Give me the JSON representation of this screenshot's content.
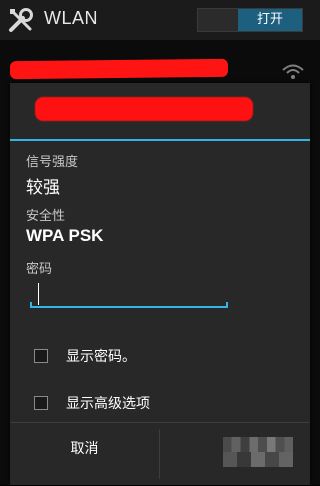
{
  "actionbar": {
    "title": "WLAN",
    "toggle_label": "打开"
  },
  "dialog": {
    "signal_label": "信号强度",
    "signal_value": "较强",
    "security_label": "安全性",
    "security_value": "WPA PSK",
    "password_label": "密码",
    "password_value": "",
    "show_password_label": "显示密码。",
    "show_password_checked": false,
    "advanced_label": "显示高级选项",
    "advanced_checked": false,
    "cancel_label": "取消"
  },
  "colors": {
    "accent": "#33b5e5",
    "toggle_on": "#1c5f7e",
    "redaction": "#ff1111",
    "dialog_bg": "#282828"
  },
  "icons": {
    "settings": "tools-icon",
    "wifi": "wifi-icon"
  }
}
